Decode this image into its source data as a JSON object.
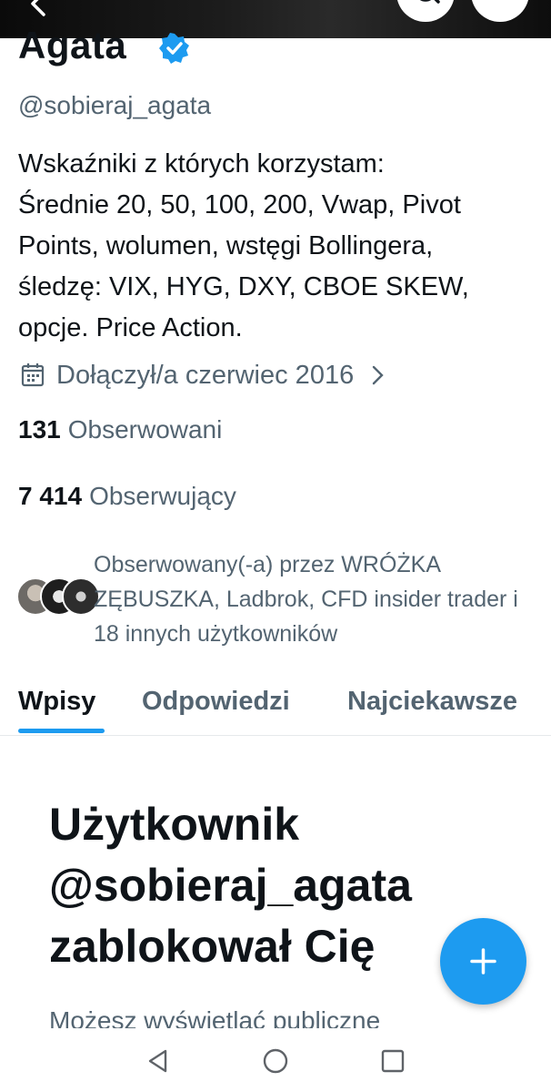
{
  "profile": {
    "name": "Agata",
    "handle": "@sobieraj_agata",
    "bio": "Wskaźniki z których korzystam:\nŚrednie 20, 50, 100, 200, Vwap, Pivot\nPoints, wolumen, wstęgi Bollingera,\nśledzę: VIX, HYG, DXY, CBOE SKEW,\nopcje. Price Action.",
    "joined": "Dołączył/a czerwiec 2016",
    "following_count": "131",
    "following_label": "Obserwowani",
    "followers_count": "7 414",
    "followers_label": "Obserwujący",
    "followed_by": "Obserwowany(-a) przez WRÓŻKA ZĘBUSZKA, Ladbrok, CFD insider trader i 18 innych użytkowników"
  },
  "tabs": [
    {
      "label": "Wpisy"
    },
    {
      "label": "Odpowiedzi"
    },
    {
      "label": "Najciekawsze"
    }
  ],
  "blocked": {
    "title": "Użytkownik @sobieraj_agata zablokował Cię",
    "subtitle": "Możesz wyświetlać publiczne"
  },
  "colors": {
    "accent": "#1d9bf0",
    "text": "#0f1419",
    "secondary": "#536471"
  },
  "icons": {
    "back": "arrow-left-icon",
    "search": "search-icon",
    "more": "more-vertical-icon",
    "verified": "verified-badge-icon",
    "calendar": "calendar-icon",
    "chevron": "chevron-right-icon",
    "compose": "plus-icon",
    "nav_back": "triangle-back-icon",
    "nav_home": "circle-home-icon",
    "nav_recent": "square-recents-icon"
  }
}
